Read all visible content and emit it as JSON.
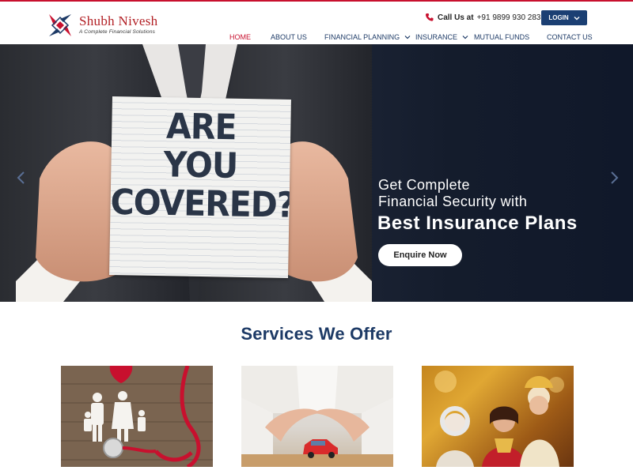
{
  "header": {
    "logo_name": "Shubh Nivesh",
    "logo_tagline": "A Complete Financial Solutions",
    "phone_label": "Call Us at",
    "phone_number": "+91 9899 930 283",
    "login_label": "LOGIN"
  },
  "nav": {
    "items": [
      {
        "label": "HOME",
        "active": true
      },
      {
        "label": "ABOUT US"
      },
      {
        "label": "FINANCIAL PLANNING",
        "dropdown": true
      },
      {
        "label": "INSURANCE",
        "dropdown": true
      },
      {
        "label": "MUTUAL FUNDS"
      },
      {
        "label": "CONTACT US"
      }
    ]
  },
  "hero": {
    "sign_line1": "ARE",
    "sign_line2": "YOU",
    "sign_line3": "COVERED?",
    "title_line1": "Get Complete",
    "title_line2": "Financial Security with",
    "title_line3": "Best Insurance Plans",
    "cta_label": "Enquire Now"
  },
  "services": {
    "title": "Services We Offer",
    "cards": [
      {
        "icon": "family-stethoscope-image"
      },
      {
        "icon": "car-protection-image"
      },
      {
        "icon": "family-portrait-image"
      }
    ]
  },
  "colors": {
    "brand_red": "#c8102e",
    "nav_blue": "#1d3a66",
    "login_blue": "#1b3f73"
  }
}
